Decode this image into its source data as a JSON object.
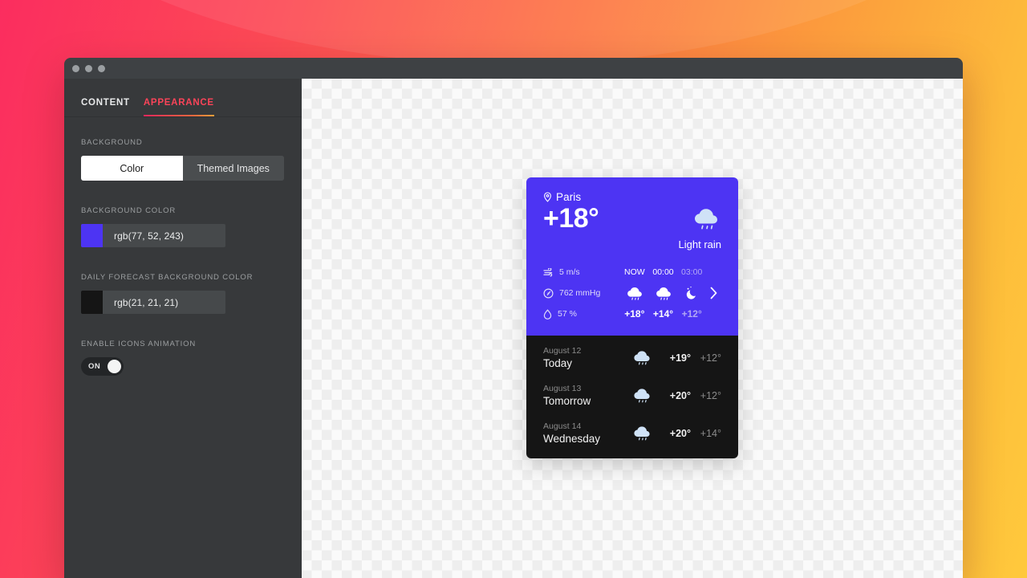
{
  "window": {
    "traffic_lights": [
      "close",
      "minimize",
      "maximize"
    ]
  },
  "sidebar": {
    "tabs": [
      {
        "label": "CONTENT",
        "active": false
      },
      {
        "label": "APPEARANCE",
        "active": true
      }
    ],
    "sections": {
      "background": {
        "label": "BACKGROUND",
        "options": [
          {
            "label": "Color",
            "selected": true
          },
          {
            "label": "Themed Images",
            "selected": false
          }
        ]
      },
      "background_color": {
        "label": "BACKGROUND COLOR",
        "value": "rgb(77, 52, 243)",
        "swatch_hex": "#4D34F3"
      },
      "daily_forecast_background_color": {
        "label": "DAILY FORECAST BACKGROUND COLOR",
        "value": "rgb(21, 21, 21)",
        "swatch_hex": "#151515"
      },
      "enable_icons_animation": {
        "label": "ENABLE ICONS ANIMATION",
        "state": "ON"
      }
    }
  },
  "widget": {
    "location": "Paris",
    "current_temp": "+18°",
    "condition": "Light rain",
    "metrics": [
      {
        "icon": "wind-icon",
        "value": "5 m/s"
      },
      {
        "icon": "pressure-icon",
        "value": "762 mmHg"
      },
      {
        "icon": "humidity-icon",
        "value": "57 %"
      }
    ],
    "hourly": [
      {
        "time": "NOW",
        "icon": "rain-cloud-icon",
        "temp": "+18°",
        "dim": false
      },
      {
        "time": "00:00",
        "icon": "rain-cloud-icon",
        "temp": "+14°",
        "dim": false
      },
      {
        "time": "03:00",
        "icon": "moon-icon",
        "temp": "+12°",
        "dim": true
      }
    ],
    "daily": [
      {
        "date": "August 12",
        "name": "Today",
        "icon": "rain-cloud-icon",
        "high": "+19°",
        "low": "+12°"
      },
      {
        "date": "August 13",
        "name": "Tomorrow",
        "icon": "rain-cloud-icon",
        "high": "+20°",
        "low": "+12°"
      },
      {
        "date": "August 14",
        "name": "Wednesday",
        "icon": "rain-cloud-icon",
        "high": "+20°",
        "low": "+14°"
      }
    ]
  },
  "theme": {
    "accent_pink": "#FB2D5F",
    "accent_orange": "#FFC93C",
    "tab_active": "#FB4459",
    "widget_purple": "#4D34F3",
    "widget_dark": "#151515",
    "sidebar_bg": "#37393B"
  }
}
